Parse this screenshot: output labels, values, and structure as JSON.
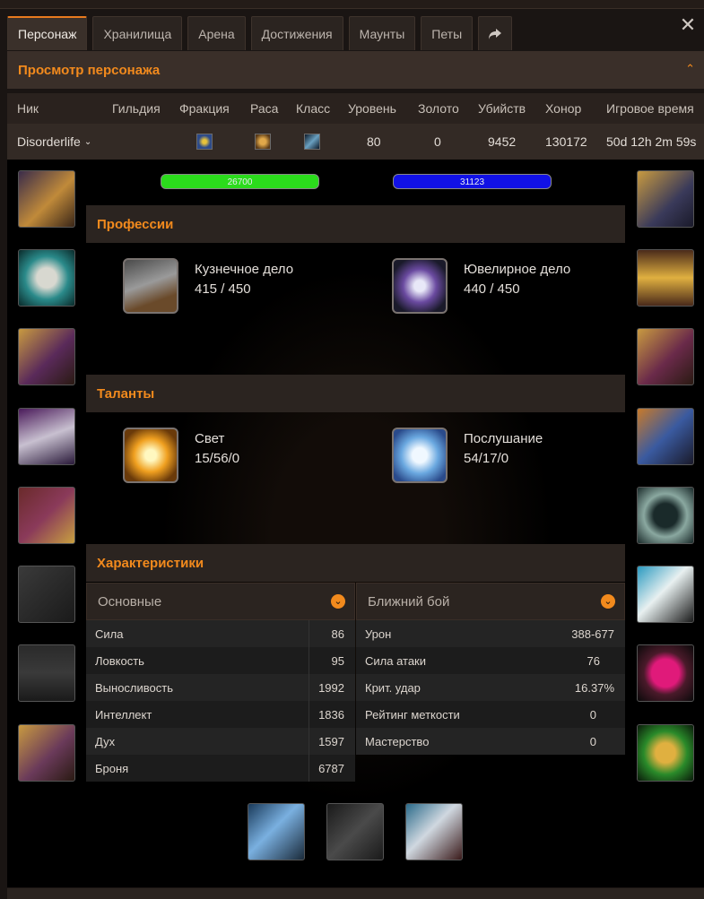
{
  "tabs": [
    {
      "label": "Персонаж"
    },
    {
      "label": "Хранилища"
    },
    {
      "label": "Арена"
    },
    {
      "label": "Достижения"
    },
    {
      "label": "Маунты"
    },
    {
      "label": "Петы"
    }
  ],
  "header": {
    "title": "Просмотр персонажа"
  },
  "table": {
    "columns": [
      "Ник",
      "Гильдия",
      "Фракция",
      "Раса",
      "Класс",
      "Уровень",
      "Золото",
      "Убийств",
      "Хонор",
      "Игровое время"
    ],
    "row": {
      "nick": "Disorderlife",
      "guild": "",
      "level": "80",
      "gold": "0",
      "kills": "9452",
      "honor": "130172",
      "playtime": "50d 12h 2m 59s"
    }
  },
  "bars": {
    "health": "26700",
    "mana": "31123"
  },
  "professions": {
    "title": "Профессии",
    "items": [
      {
        "name": "Кузнечное дело",
        "value": "415 / 450"
      },
      {
        "name": "Ювелирное дело",
        "value": "440 / 450"
      }
    ]
  },
  "talents": {
    "title": "Таланты",
    "items": [
      {
        "name": "Свет",
        "value": "15/56/0"
      },
      {
        "name": "Послушание",
        "value": "54/17/0"
      }
    ]
  },
  "characteristics": {
    "title": "Характеристики",
    "left": {
      "select": "Основные",
      "rows": [
        {
          "k": "Сила",
          "v": "86"
        },
        {
          "k": "Ловкость",
          "v": "95"
        },
        {
          "k": "Выносливость",
          "v": "1992"
        },
        {
          "k": "Интеллект",
          "v": "1836"
        },
        {
          "k": "Дух",
          "v": "1597"
        },
        {
          "k": "Броня",
          "v": "6787"
        }
      ]
    },
    "right": {
      "select": "Ближний бой",
      "rows": [
        {
          "k": "Урон",
          "v": "388-677"
        },
        {
          "k": "Сила атаки",
          "v": "76"
        },
        {
          "k": "Крит. удар",
          "v": "16.37%"
        },
        {
          "k": "Рейтинг меткости",
          "v": "0"
        },
        {
          "k": "Мастерство",
          "v": "0"
        }
      ]
    }
  },
  "colors": {
    "accent": "#f28a1d",
    "health": "#2bdc1c",
    "mana": "#1111e6"
  }
}
